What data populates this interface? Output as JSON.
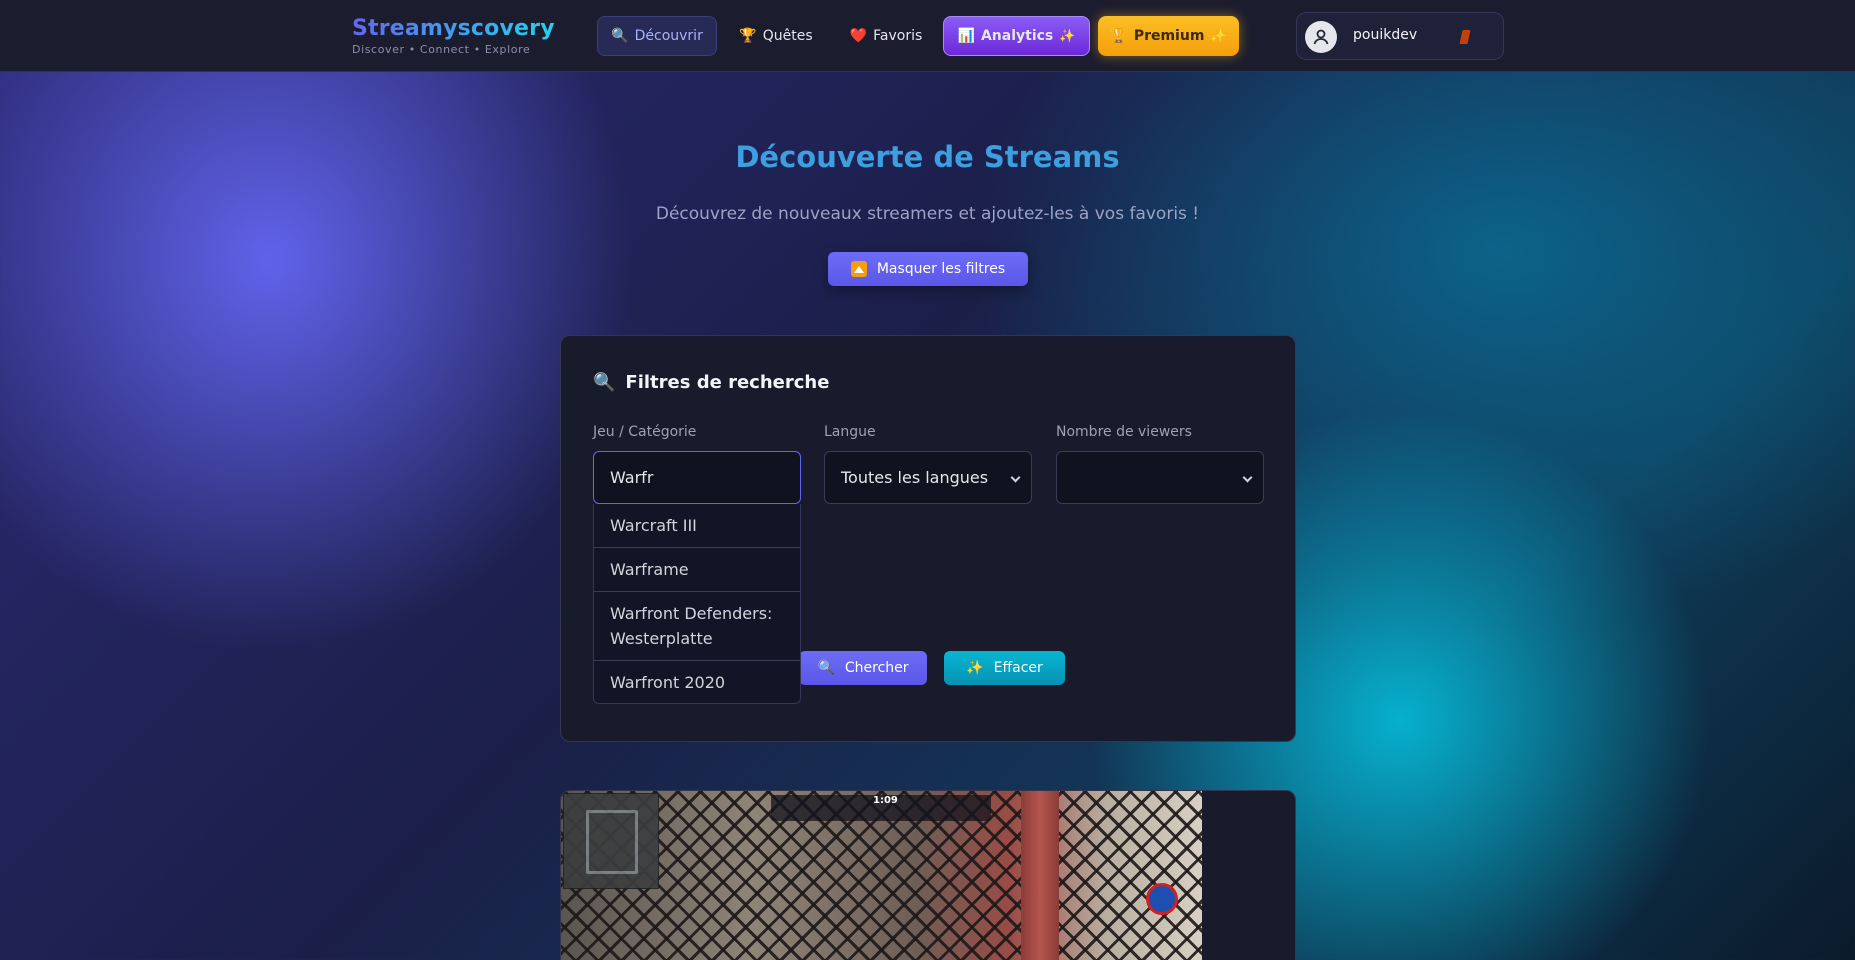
{
  "header": {
    "brand_title": "Streamyscovery",
    "brand_subtitle": "Discover • Connect • Explore",
    "nav": {
      "discover": "Découvrir",
      "quests": "Quêtes",
      "favorites": "Favoris",
      "analytics": "Analytics",
      "premium": "Premium"
    },
    "icons": {
      "discover": "🔍",
      "quests": "🏆",
      "favorites": "❤️",
      "analytics": "📊",
      "premium": "🏆",
      "sparkle": "✨"
    },
    "user": {
      "name": "pouikdev"
    }
  },
  "hero": {
    "title": "Découverte de Streams",
    "subtitle": "Découvrez de nouveaux streamers et ajoutez-les à vos favoris !",
    "toggle_label": "Masquer les filtres"
  },
  "filters": {
    "title": "Filtres de recherche",
    "title_icon": "🔍",
    "game_label": "Jeu / Catégorie",
    "game_value": "Warfr",
    "language_label": "Langue",
    "language_value": "Toutes les langues",
    "viewers_label": "Nombre de viewers",
    "viewers_value": "",
    "suggestions": [
      "Warcraft III",
      "Warframe",
      "Warfront Defenders: Westerplatte",
      "Warfront 2020"
    ],
    "search_label": "Chercher",
    "search_icon": "🔍",
    "clear_label": "Effacer",
    "clear_icon": "✨"
  },
  "stream_preview": {
    "hud_time": "1:09"
  },
  "colors": {
    "accent": "#6366f1",
    "cyan": "#06b6d4",
    "premium": "#fbbf24",
    "analytics": "#8b5cf6"
  }
}
